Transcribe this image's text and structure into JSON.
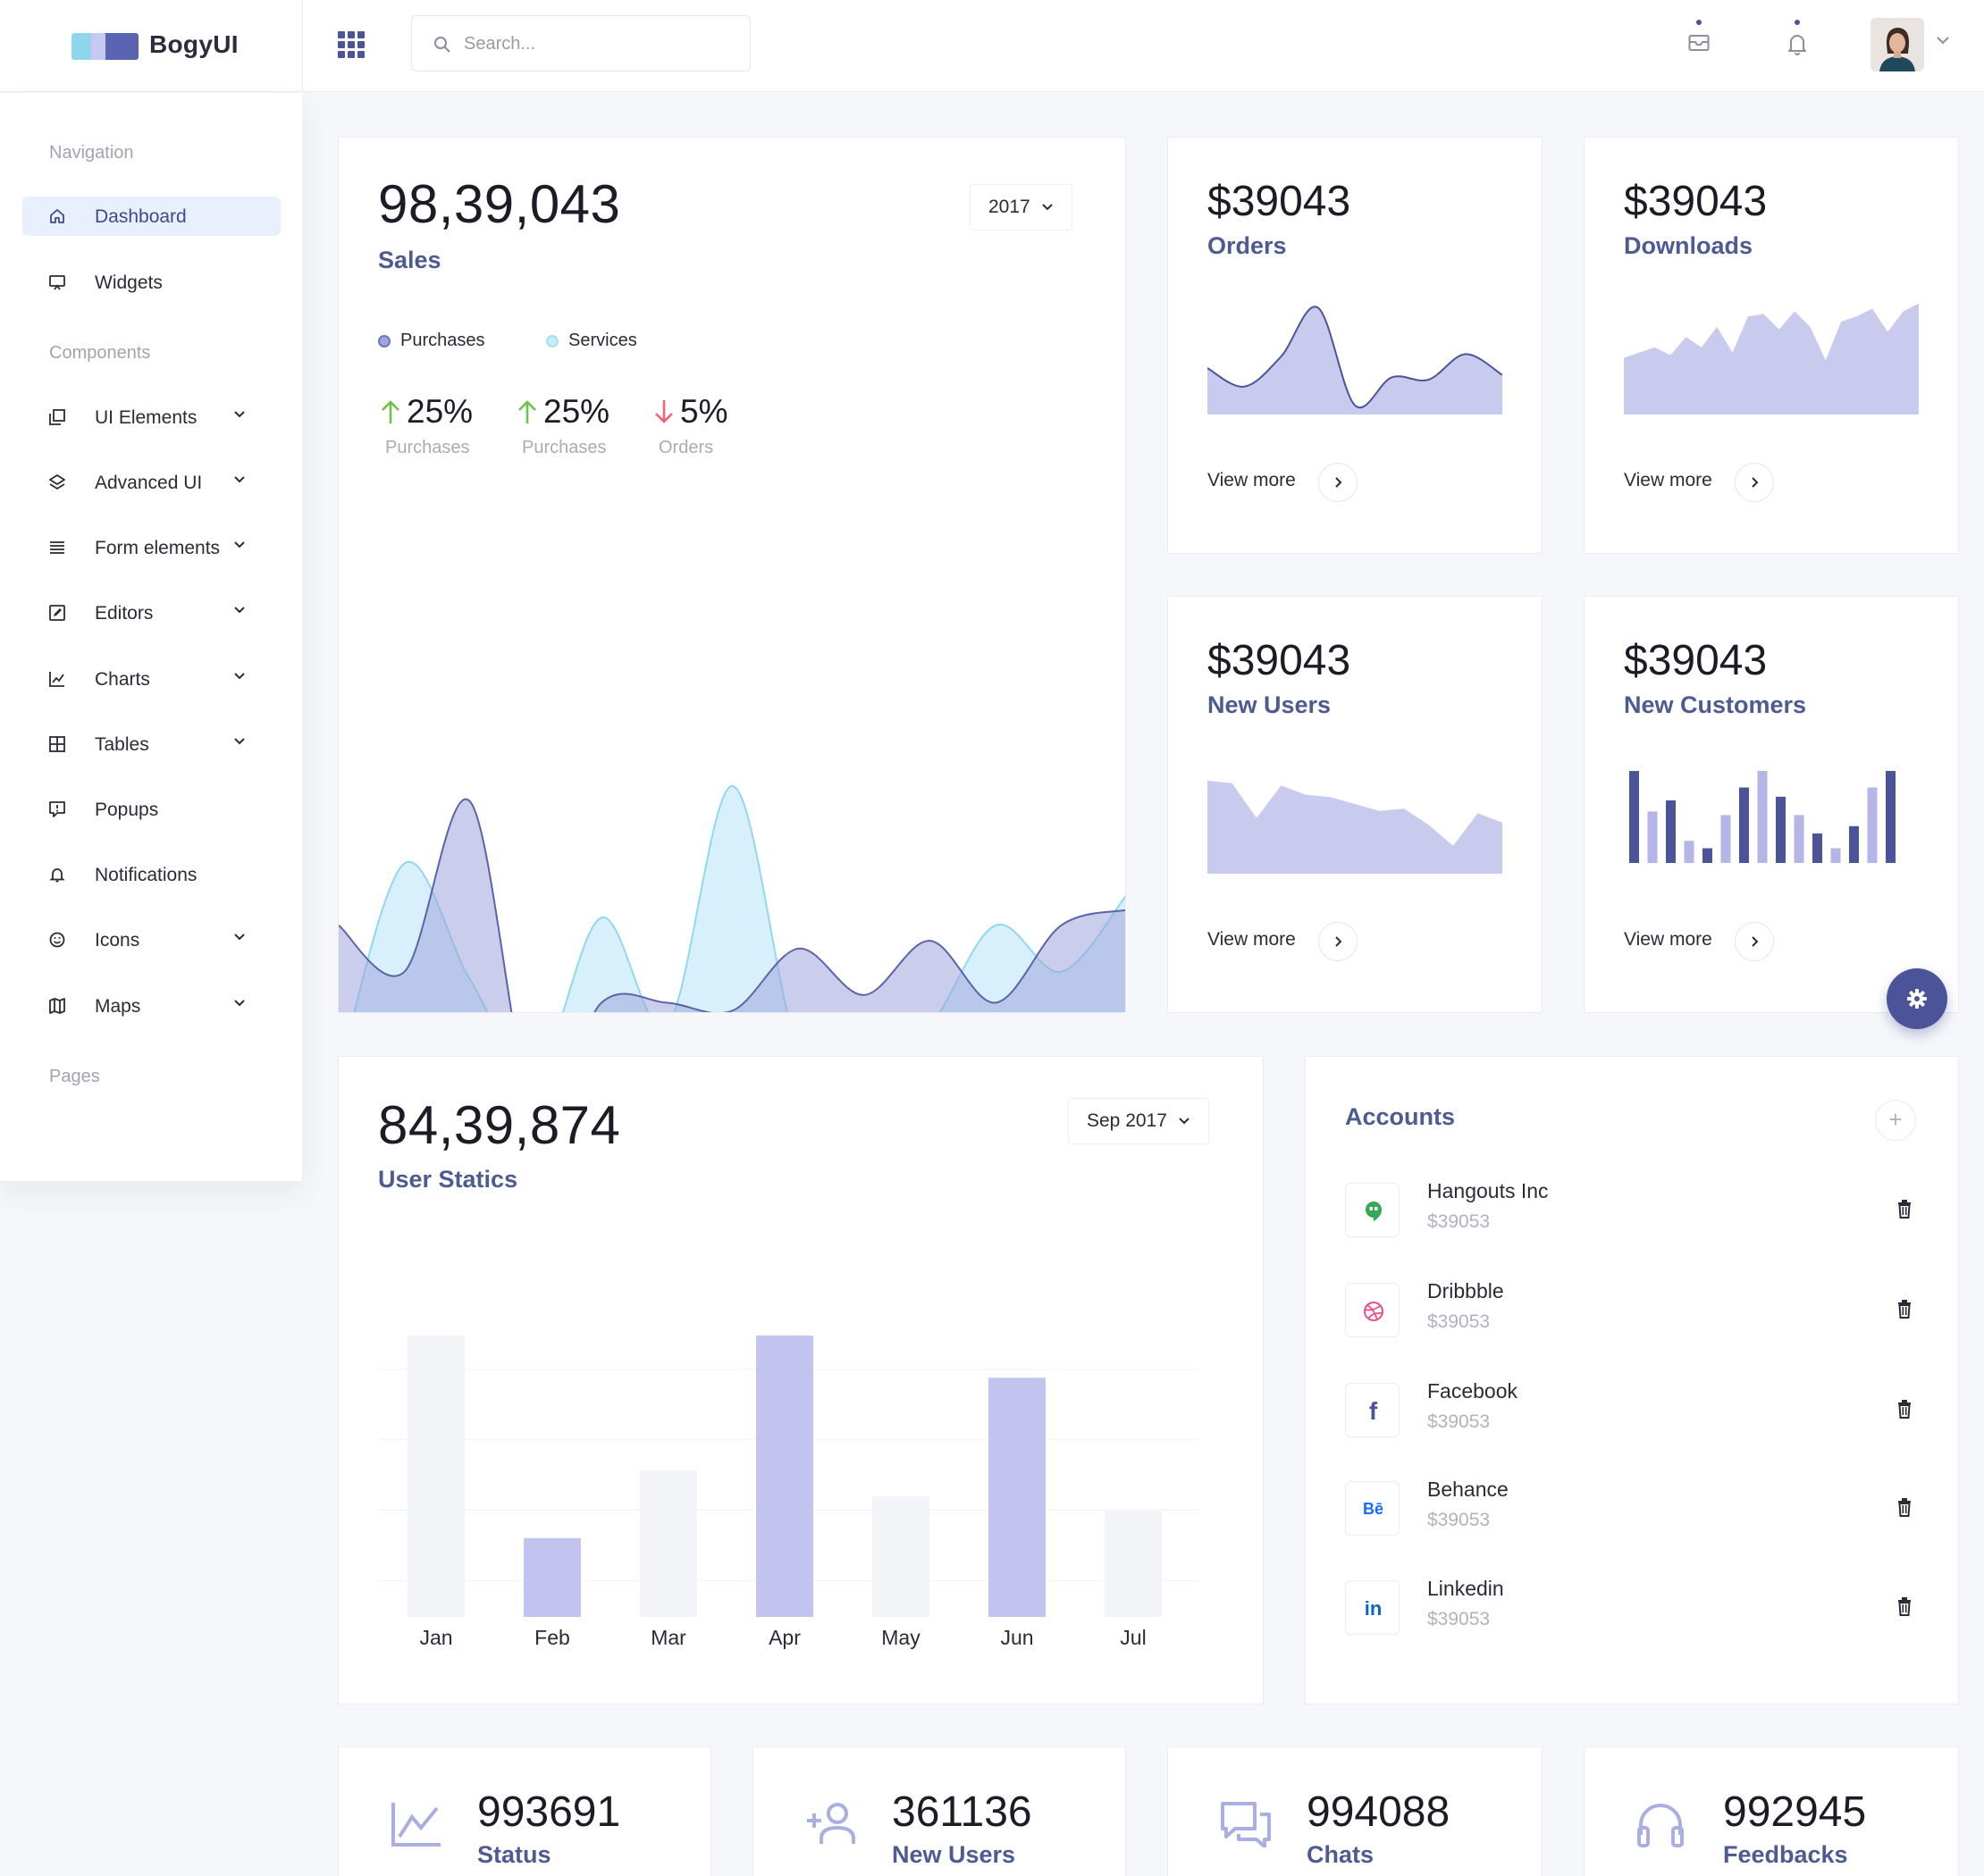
{
  "brand": {
    "name": "BogyUI",
    "logo_colors": [
      "#8fd6ec",
      "#c6c9f0",
      "#5b63b3"
    ]
  },
  "header": {
    "search_placeholder": "Search...",
    "icons": [
      "apps-grid-icon",
      "mail-icon",
      "bell-icon"
    ]
  },
  "sidebar": {
    "headings": [
      "Navigation",
      "Components",
      "Pages"
    ],
    "items": [
      {
        "label": "Dashboard",
        "icon": "home-icon",
        "active": true
      },
      {
        "label": "Widgets",
        "icon": "monitor-icon"
      },
      {
        "label": "UI Elements",
        "icon": "copy-icon",
        "has_submenu": true
      },
      {
        "label": "Advanced UI",
        "icon": "layers-icon",
        "has_submenu": true
      },
      {
        "label": "Form elements",
        "icon": "list-icon",
        "has_submenu": true
      },
      {
        "label": "Editors",
        "icon": "edit-icon",
        "has_submenu": true
      },
      {
        "label": "Charts",
        "icon": "chart-icon",
        "has_submenu": true
      },
      {
        "label": "Tables",
        "icon": "table-icon",
        "has_submenu": true
      },
      {
        "label": "Popups",
        "icon": "popup-icon"
      },
      {
        "label": "Notifications",
        "icon": "bell-icon"
      },
      {
        "label": "Icons",
        "icon": "smile-icon",
        "has_submenu": true
      },
      {
        "label": "Maps",
        "icon": "map-icon",
        "has_submenu": true
      }
    ]
  },
  "sales": {
    "value": "98,39,043",
    "label": "Sales",
    "year": "2017",
    "legend": [
      {
        "name": "Purchases",
        "color": "#9fa5dc"
      },
      {
        "name": "Services",
        "color": "#c6ecf8"
      }
    ],
    "stats": [
      {
        "value": "25%",
        "label": "Purchases",
        "trend": "up"
      },
      {
        "value": "25%",
        "label": "Purchases",
        "trend": "up"
      },
      {
        "value": "5%",
        "label": "Orders",
        "trend": "down"
      }
    ]
  },
  "mini_cards": [
    {
      "value": "$39043",
      "label": "Orders",
      "link": "View more"
    },
    {
      "value": "$39043",
      "label": "Downloads",
      "link": "View more"
    },
    {
      "value": "$39043",
      "label": "New Users",
      "link": "View more"
    },
    {
      "value": "$39043",
      "label": "New Customers",
      "link": "View more"
    }
  ],
  "user_statics": {
    "value": "84,39,874",
    "label": "User Statics",
    "period": "Sep 2017"
  },
  "accounts": {
    "title": "Accounts",
    "items": [
      {
        "name": "Hangouts Inc",
        "amount": "$39053",
        "icon": "hangouts-icon",
        "color": "#34a853"
      },
      {
        "name": "Dribbble",
        "amount": "$39053",
        "icon": "dribbble-icon",
        "color": "#ea4c89"
      },
      {
        "name": "Facebook",
        "amount": "$39053",
        "icon": "facebook-icon",
        "color": "#4b5499",
        "glyph": "f"
      },
      {
        "name": "Behance",
        "amount": "$39053",
        "icon": "behance-icon",
        "color": "#1769ff",
        "glyph": "Bē"
      },
      {
        "name": "Linkedin",
        "amount": "$39053",
        "icon": "linkedin-icon",
        "color": "#0a66c2",
        "glyph": "in"
      }
    ]
  },
  "summary": [
    {
      "value": "993691",
      "label": "Status",
      "icon": "trend-line-icon"
    },
    {
      "value": "361136",
      "label": "New Users",
      "icon": "add-user-icon"
    },
    {
      "value": "994088",
      "label": "Chats",
      "icon": "chat-icon"
    },
    {
      "value": "992945",
      "label": "Feedbacks",
      "icon": "headphones-icon"
    }
  ],
  "chart_data": [
    {
      "type": "area",
      "x": [
        0,
        1,
        2,
        3,
        4,
        5,
        6,
        7,
        8,
        9,
        10,
        11,
        12
      ],
      "series": [
        {
          "name": "Purchases",
          "values": [
            2.9,
            2.3,
            4.5,
            0.4,
            1.9,
            1.9,
            1.8,
            2.6,
            2.0,
            2.7,
            1.9,
            2.9,
            3.1
          ]
        },
        {
          "name": "Services",
          "values": [
            1.0,
            3.7,
            2.2,
            1.0,
            3.0,
            1.6,
            4.7,
            1.3,
            1.0,
            1.6,
            2.9,
            2.3,
            3.3
          ]
        }
      ],
      "ylim": [
        0,
        5
      ]
    },
    {
      "type": "area",
      "values": [
        2.0,
        1.2,
        2.5,
        4.6,
        0.4,
        1.6,
        1.5,
        2.6,
        1.7
      ]
    },
    {
      "type": "area",
      "values": [
        2.2,
        2.4,
        2.6,
        2.3,
        3.0,
        2.6,
        3.4,
        2.4,
        3.8,
        3.9,
        3.3,
        4.0,
        3.4,
        2.1,
        3.6,
        3.8,
        4.1,
        3.2,
        4.0,
        4.3
      ]
    },
    {
      "type": "area",
      "values": [
        4.0,
        3.9,
        2.4,
        3.8,
        3.4,
        3.3,
        3.0,
        2.7,
        2.8,
        2.1,
        1.2,
        2.6,
        2.2
      ]
    },
    {
      "type": "bar",
      "values": [
        5.0,
        2.8,
        3.4,
        1.2,
        0.8,
        2.6,
        4.1,
        5.0,
        3.6,
        2.6,
        1.6,
        0.8,
        2.0,
        4.1,
        5.0
      ]
    },
    {
      "type": "bar",
      "categories": [
        "Jan",
        "Feb",
        "Mar",
        "Apr",
        "May",
        "Jun",
        "Jul"
      ],
      "values": [
        100,
        28,
        52,
        100,
        43,
        85,
        38
      ],
      "ylim": [
        0,
        100
      ]
    }
  ]
}
